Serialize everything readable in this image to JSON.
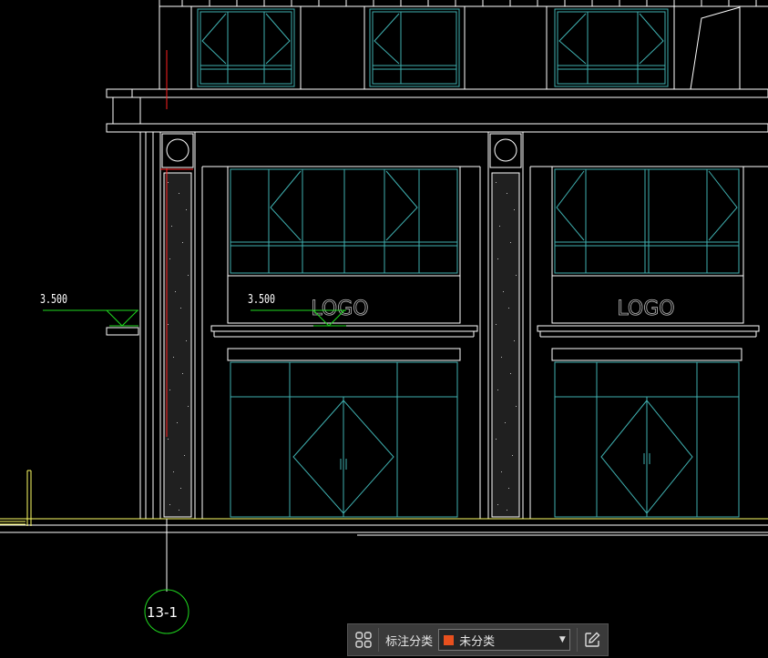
{
  "drawing": {
    "elevation_left": "3.500",
    "elevation_center": "3.500",
    "logo_left": "LOGO",
    "logo_right": "LOGO",
    "grid_bubble": "13-1"
  },
  "toolbar": {
    "label": "标注分类",
    "category_value": "未分类",
    "swatch_color": "#e8501e",
    "grid_icon": "grid-2x2-icon",
    "edit_icon": "edit-icon"
  },
  "colors": {
    "background": "#000000",
    "lines": "#ffffff",
    "glass": "#3fb0b0",
    "dimension": "#1fd81f",
    "ground": "#ffff66",
    "axis": "#ff2020"
  }
}
